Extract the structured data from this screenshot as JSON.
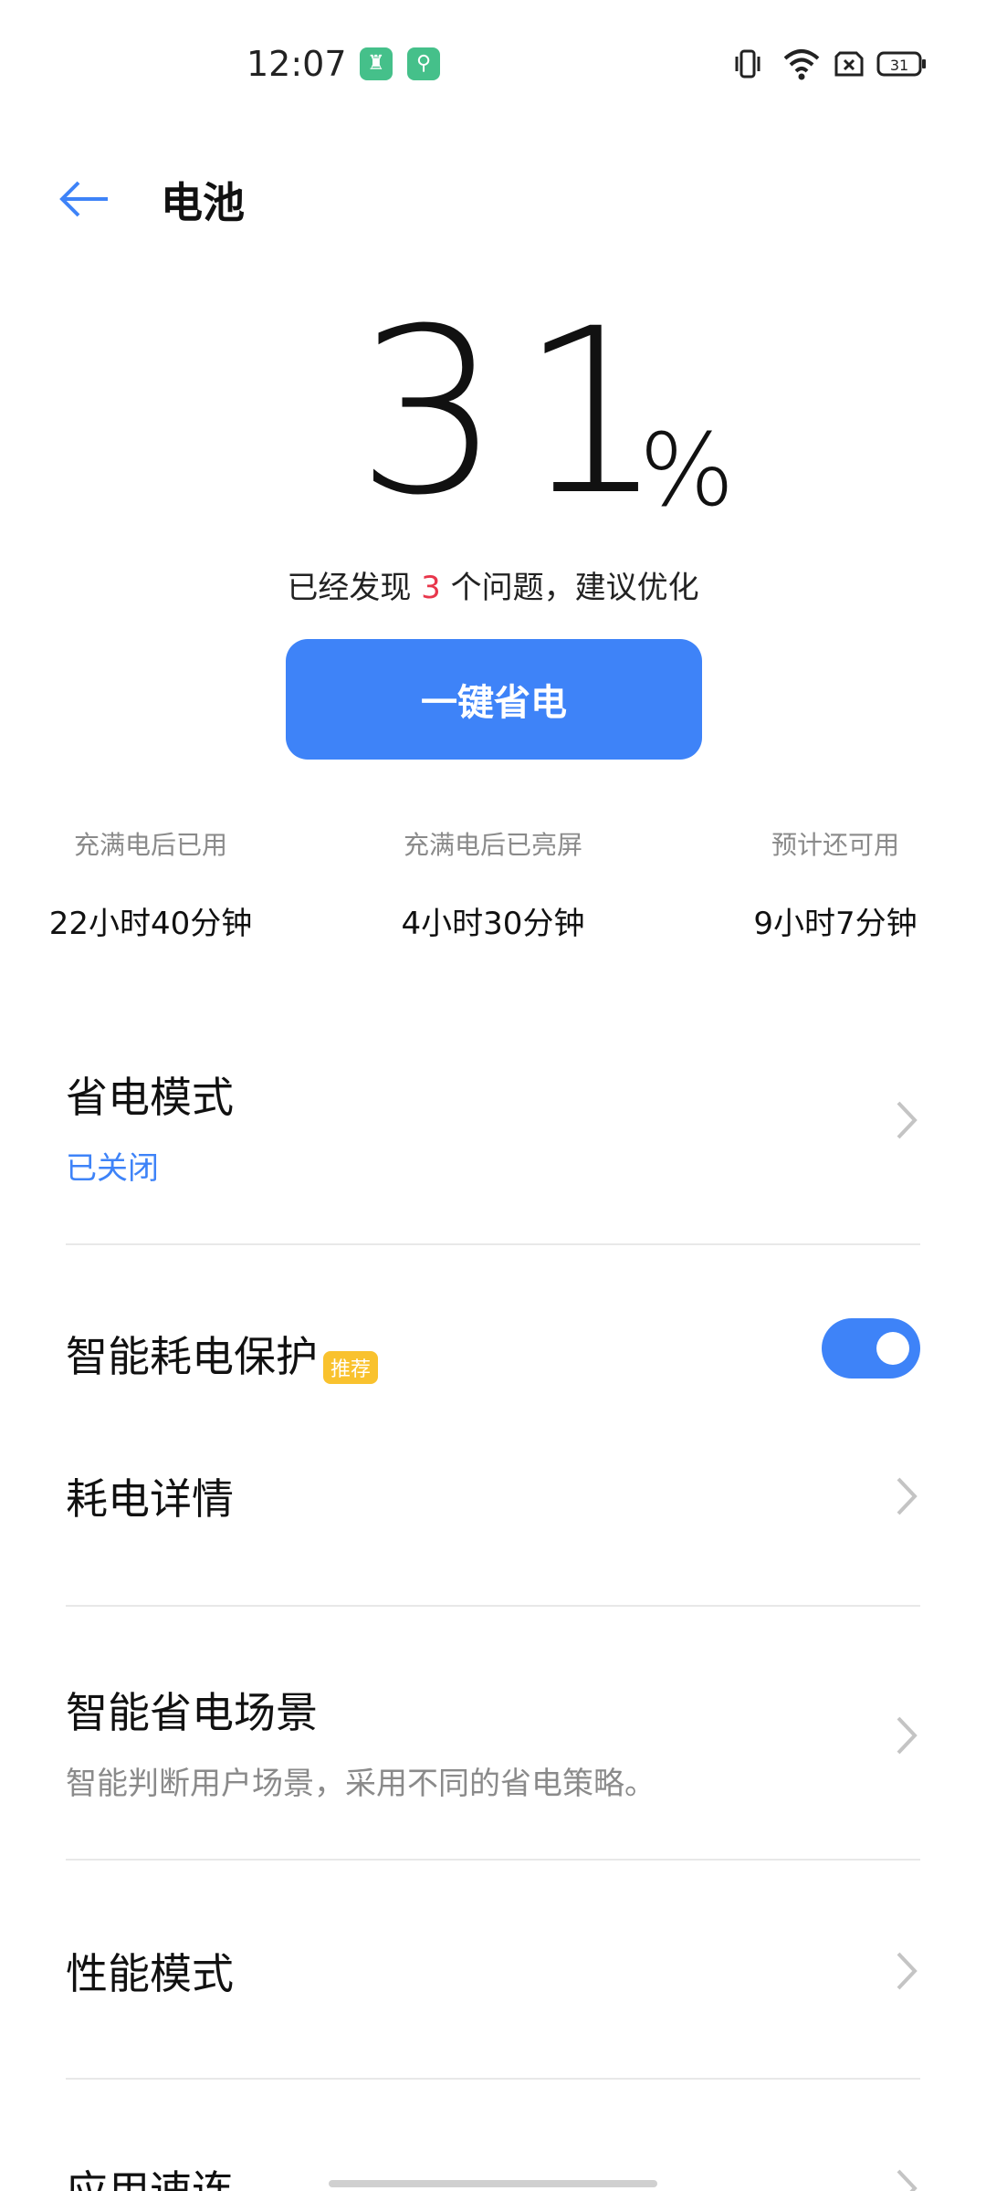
{
  "status_bar": {
    "time": "12:07",
    "battery_level": "31",
    "icons": [
      "app-notification-icon",
      "key-notification-icon",
      "vibrate-icon",
      "wifi-icon",
      "no-sim-icon",
      "battery-icon"
    ]
  },
  "header": {
    "title": "电池",
    "back_icon": "arrow-left-icon"
  },
  "battery": {
    "percent": "31",
    "unit": "%",
    "issue_prefix": "已经发现 ",
    "issue_count": "3",
    "issue_suffix": " 个问题，建议优化",
    "save_button": "一键省电"
  },
  "stats": [
    {
      "label": "充满电后已用",
      "value": "22小时40分钟"
    },
    {
      "label": "充满电后已亮屏",
      "value": "4小时30分钟"
    },
    {
      "label": "预计还可用",
      "value": "9小时7分钟"
    }
  ],
  "settings": {
    "power_saving_mode": {
      "title": "省电模式",
      "status": "已关闭"
    },
    "smart_protection": {
      "title": "智能耗电保护",
      "badge": "推荐",
      "enabled": true
    },
    "consumption_details": {
      "title": "耗电详情"
    },
    "smart_scenes": {
      "title": "智能省电场景",
      "subtitle": "智能判断用户场景，采用不同的省电策略。"
    },
    "performance_mode": {
      "title": "性能模式"
    },
    "app_launch": {
      "title": "应用速连"
    }
  },
  "colors": {
    "accent": "#3e83f8",
    "highlight_red": "#e8364b",
    "badge_yellow": "#f9c22e"
  }
}
